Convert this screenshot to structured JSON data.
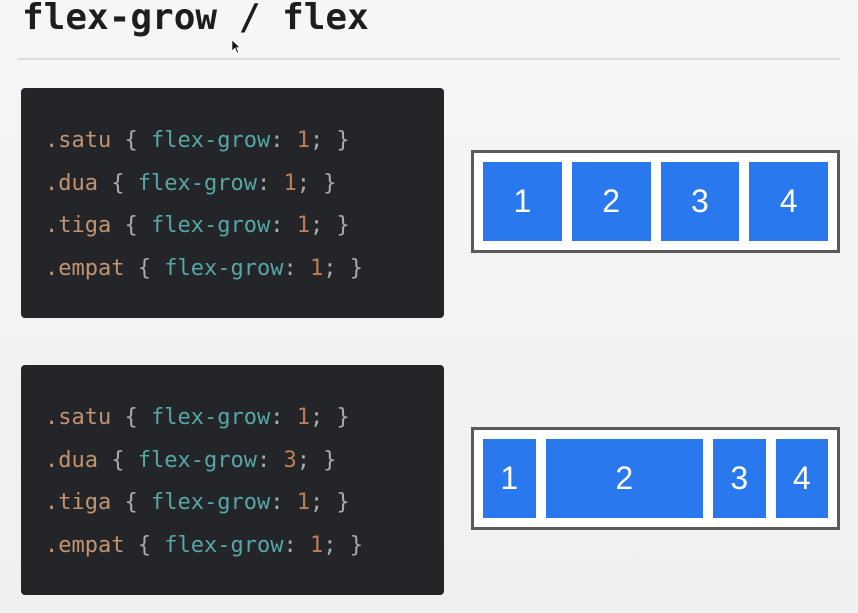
{
  "title": "flex-grow / flex",
  "colors": {
    "accent_blue": "#2a78ee",
    "code_bg": "#232529",
    "selector": "#d7a37a",
    "property": "#5db8b6",
    "value": "#d58a5a"
  },
  "examples": [
    {
      "code": [
        {
          "selector": ".satu",
          "open": "{",
          "property": "flex-grow",
          "colon": ":",
          "value": "1",
          "semicolon": ";",
          "close": "}"
        },
        {
          "selector": ".dua",
          "open": "{",
          "property": "flex-grow",
          "colon": ":",
          "value": "1",
          "semicolon": ";",
          "close": "}"
        },
        {
          "selector": ".tiga",
          "open": "{",
          "property": "flex-grow",
          "colon": ":",
          "value": "1",
          "semicolon": ";",
          "close": "}"
        },
        {
          "selector": ".empat",
          "open": "{",
          "property": "flex-grow",
          "colon": ":",
          "value": "1",
          "semicolon": ";",
          "close": "}"
        }
      ],
      "items": [
        {
          "label": "1",
          "grow": 1
        },
        {
          "label": "2",
          "grow": 1
        },
        {
          "label": "3",
          "grow": 1
        },
        {
          "label": "4",
          "grow": 1
        }
      ]
    },
    {
      "code": [
        {
          "selector": ".satu",
          "open": "{",
          "property": "flex-grow",
          "colon": ":",
          "value": "1",
          "semicolon": ";",
          "close": "}"
        },
        {
          "selector": ".dua",
          "open": "{",
          "property": "flex-grow",
          "colon": ":",
          "value": "3",
          "semicolon": ";",
          "close": "}"
        },
        {
          "selector": ".tiga",
          "open": "{",
          "property": "flex-grow",
          "colon": ":",
          "value": "1",
          "semicolon": ";",
          "close": "}"
        },
        {
          "selector": ".empat",
          "open": "{",
          "property": "flex-grow",
          "colon": ":",
          "value": "1",
          "semicolon": ";",
          "close": "}"
        }
      ],
      "items": [
        {
          "label": "1",
          "grow": 1
        },
        {
          "label": "2",
          "grow": 3
        },
        {
          "label": "3",
          "grow": 1
        },
        {
          "label": "4",
          "grow": 1
        }
      ]
    }
  ]
}
